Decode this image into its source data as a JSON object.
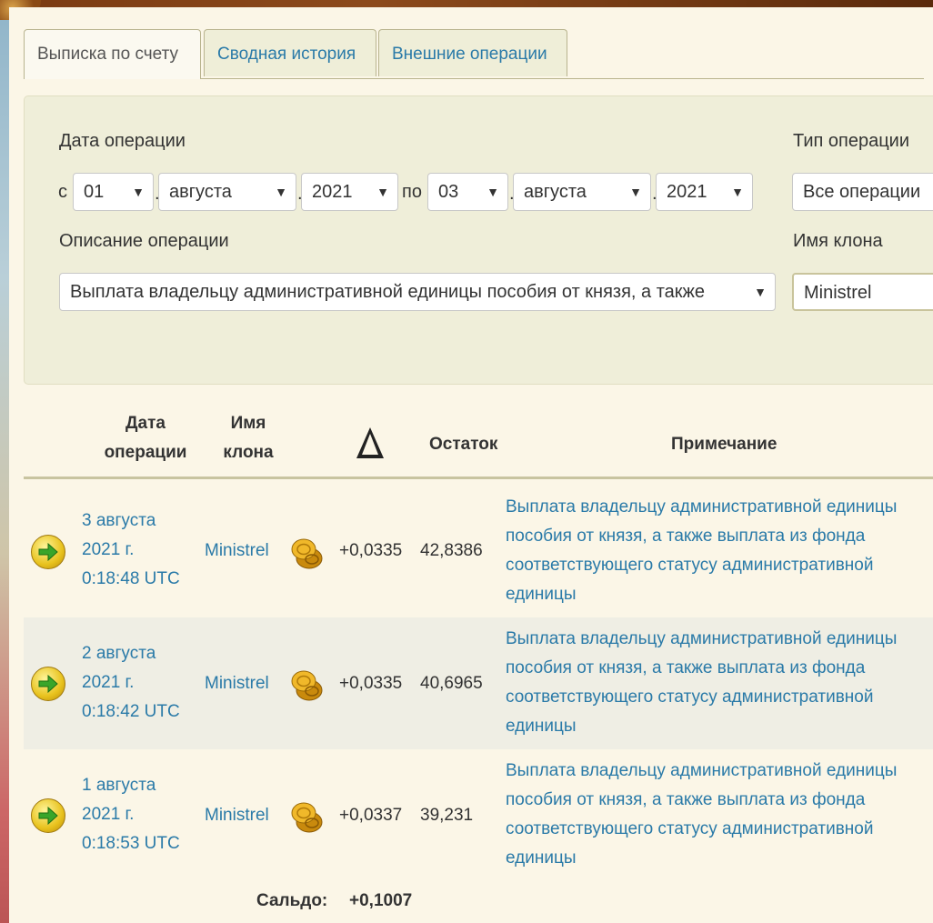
{
  "tabs": [
    "Выписка по счету",
    "Сводная история",
    "Внешние операции"
  ],
  "filter": {
    "date_label": "Дата операции",
    "from_label": "с",
    "to_label": "по",
    "from_day": "01",
    "from_month": "августа",
    "from_year": "2021",
    "to_day": "03",
    "to_month": "августа",
    "to_year": "2021",
    "type_label": "Тип операции",
    "type_value": "Все операции",
    "desc_label": "Описание операции",
    "desc_value": "Выплата владельцу административной единицы пособия от князя, а также",
    "clone_label": "Имя клона",
    "clone_value": "Ministrel"
  },
  "table": {
    "headers": {
      "date_line1": "Дата",
      "date_line2": "операции",
      "name_line1": "Имя",
      "name_line2": "клона",
      "balance": "Остаток",
      "note": "Примечание"
    },
    "rows": [
      {
        "date1": "3 августа",
        "date2": "2021 г.",
        "date3": "0:18:48 UTC",
        "name": "Ministrel",
        "delta": "+0,0335",
        "balance": "42,8386",
        "note": "Выплата владельцу административной единицы пособия от князя, а также выплата из фонда соответствующего статусу административной единицы"
      },
      {
        "date1": "2 августа",
        "date2": "2021 г.",
        "date3": "0:18:42 UTC",
        "name": "Ministrel",
        "delta": "+0,0335",
        "balance": "40,6965",
        "note": "Выплата владельцу административной единицы пособия от князя, а также выплата из фонда соответствующего статусу административной единицы"
      },
      {
        "date1": "1 августа",
        "date2": "2021 г.",
        "date3": "0:18:53 UTC",
        "name": "Ministrel",
        "delta": "+0,0337",
        "balance": "39,231",
        "note": "Выплата владельцу административной единицы пособия от князя, а также выплата из фонда соответствующего статусу административной единицы"
      }
    ],
    "total_label": "Сальдо:",
    "total_value": "+0,1007"
  },
  "icons": {
    "row_action": "arrow-right-icon",
    "currency": "gold-coins-icon",
    "delta_header": "delta-icon"
  },
  "colors": {
    "link": "#2a7aa8",
    "panel": "#efeed9",
    "accent_arrow": "#3aa52a",
    "coin": "#e3a817"
  }
}
